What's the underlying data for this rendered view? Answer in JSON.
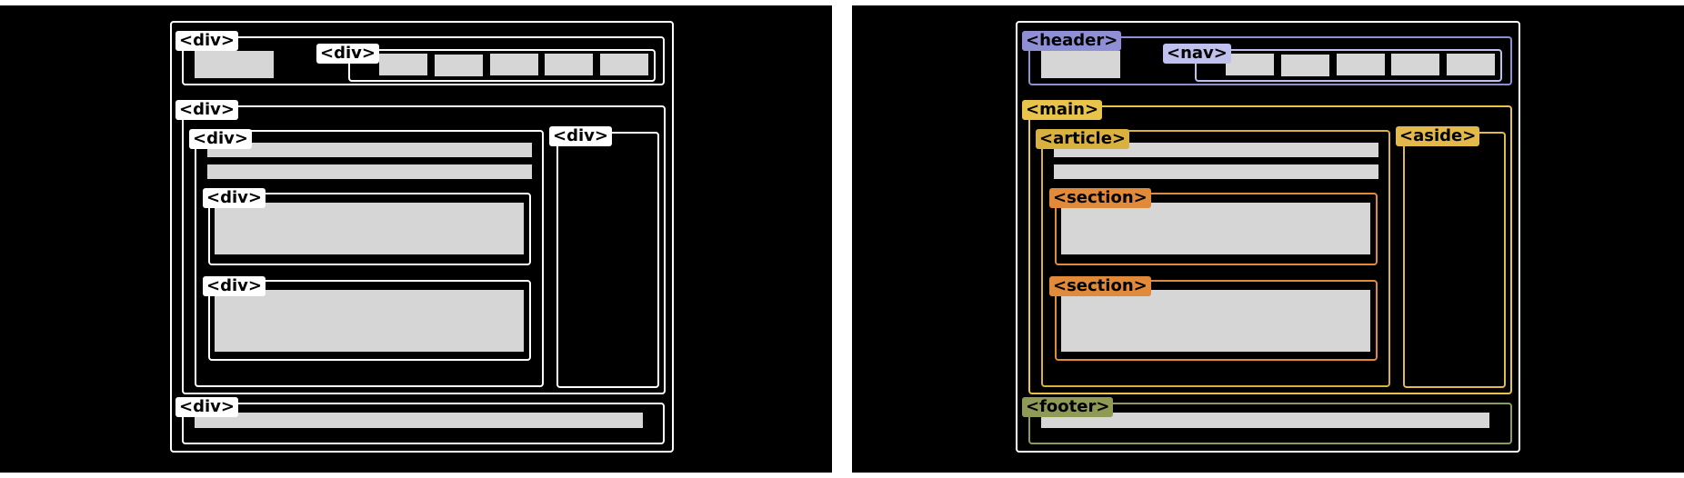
{
  "left_panel": {
    "labels": {
      "header": "<div>",
      "nav": "<div>",
      "main": "<div>",
      "article": "<div>",
      "aside": "<div>",
      "section_1": "<div>",
      "section_2": "<div>",
      "footer": "<div>"
    }
  },
  "right_panel": {
    "labels": {
      "header": "<header>",
      "nav": "<nav>",
      "main": "<main>",
      "article": "<article>",
      "aside": "<aside>",
      "section_1": "<section>",
      "section_2": "<section>",
      "footer": "<footer>"
    }
  },
  "colors": {
    "background": "#000000",
    "placeholder_block": "#d6d6d6",
    "div_outline": "#ffffff",
    "header": "#8f8fd6",
    "nav": "#c0c0ee",
    "main": "#e8c44a",
    "article": "#d9b13f",
    "aside": "#e3b94a",
    "section": "#e08a3a",
    "footer": "#8f9a55"
  }
}
